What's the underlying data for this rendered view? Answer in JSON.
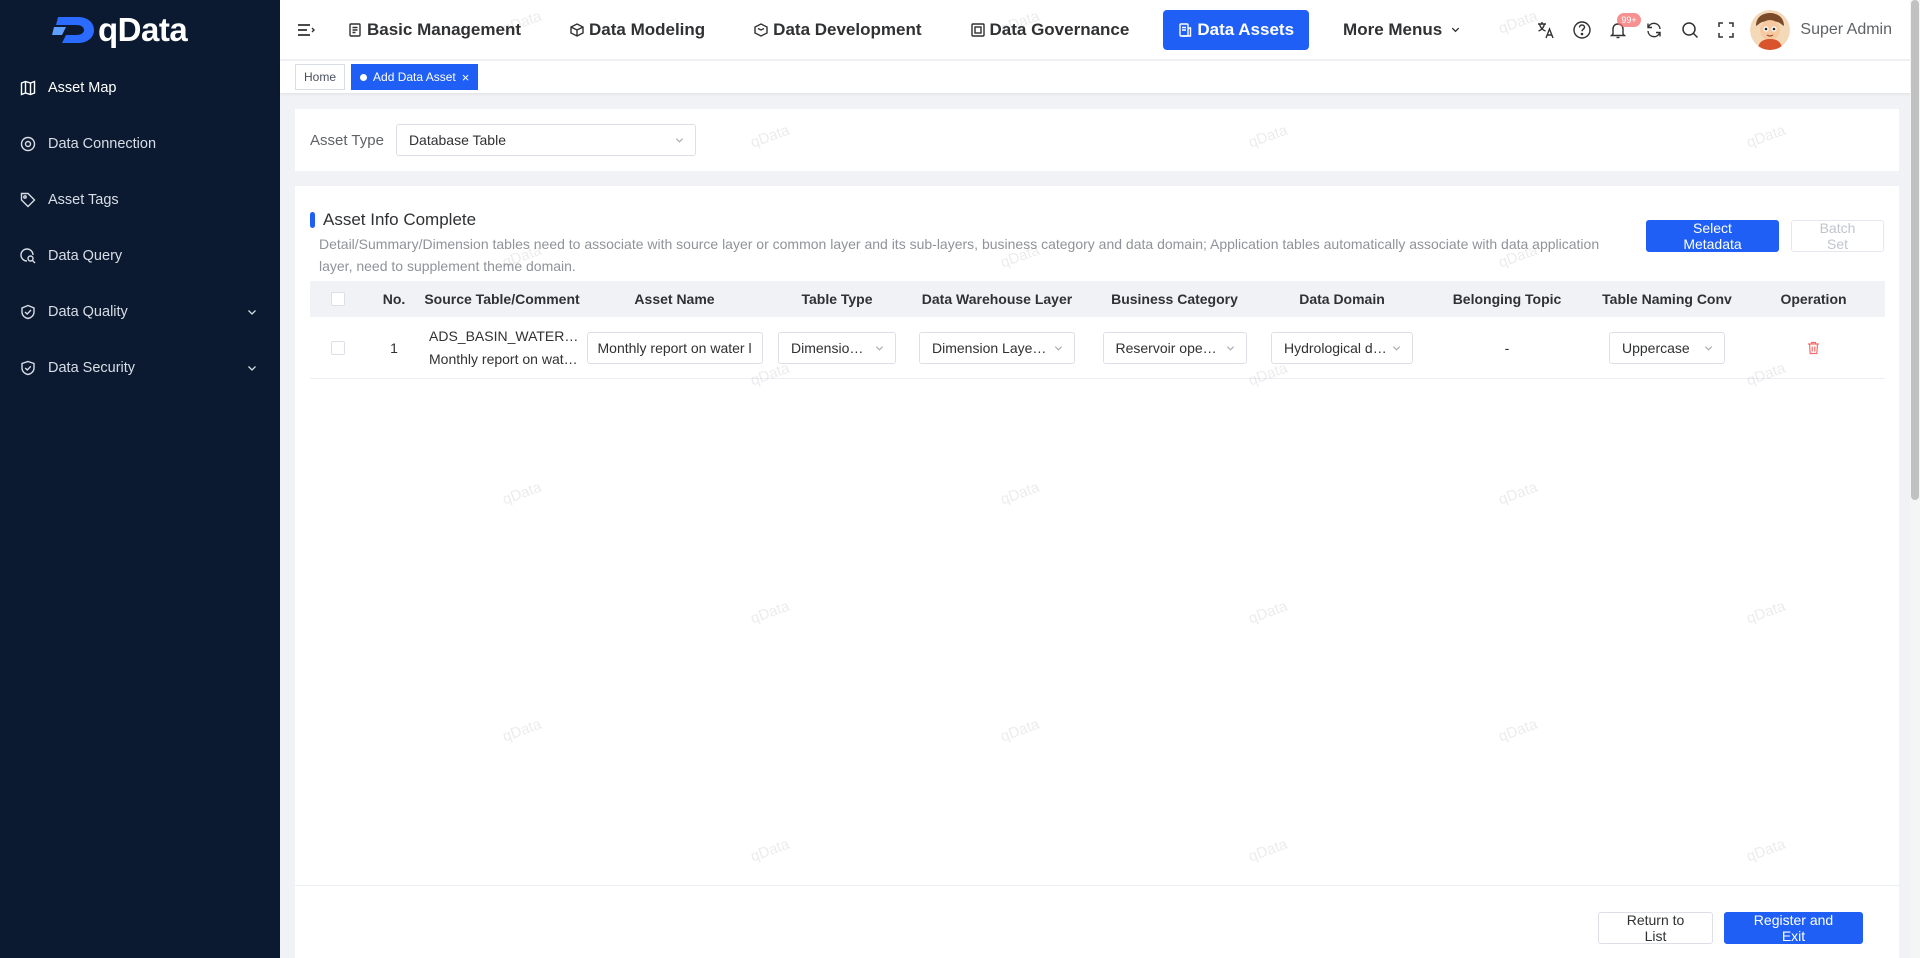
{
  "app": {
    "name": "qData"
  },
  "sidebar": {
    "items": [
      {
        "label": "Asset Map",
        "icon": "map-icon",
        "expandable": false
      },
      {
        "label": "Data Connection",
        "icon": "connection-icon",
        "expandable": false
      },
      {
        "label": "Asset Tags",
        "icon": "tag-icon",
        "expandable": false
      },
      {
        "label": "Data Query",
        "icon": "query-icon",
        "expandable": false
      },
      {
        "label": "Data Quality",
        "icon": "quality-icon",
        "expandable": true
      },
      {
        "label": "Data Security",
        "icon": "shield-icon",
        "expandable": true
      }
    ]
  },
  "topnav": {
    "items": [
      {
        "label": "Basic Management"
      },
      {
        "label": "Data Modeling"
      },
      {
        "label": "Data Development"
      },
      {
        "label": "Data Governance"
      },
      {
        "label": "Data Assets",
        "active": true
      },
      {
        "label": "More Menus"
      }
    ]
  },
  "header": {
    "notification_badge": "99+",
    "username": "Super Admin"
  },
  "tabs": {
    "home": "Home",
    "active": "Add Data Asset",
    "close_glyph": "×"
  },
  "asset_type": {
    "label": "Asset Type",
    "value": "Database Table"
  },
  "section": {
    "title": "Asset Info Complete",
    "description": "Detail/Summary/Dimension tables need to associate with source layer or common layer and its sub-layers, business category and data domain; Application tables automatically associate with data application layer, need to supplement theme domain.",
    "select_metadata_label": "Select Metadata",
    "batch_set_label": "Batch Set"
  },
  "table": {
    "columns": [
      "No.",
      "Source Table/Comment",
      "Asset Name",
      "Table Type",
      "Data Warehouse Layer",
      "Business Category",
      "Data Domain",
      "Belonging Topic",
      "Table Naming Conv",
      "Operation"
    ],
    "rows": [
      {
        "no": "1",
        "source_table": "ADS_BASIN_WATER_MONTHLY_REPORT",
        "source_comment": "Monthly report on water level of basin",
        "asset_name": "Monthly report on water level of basin",
        "table_type": "Dimension Table",
        "dw_layer": "Dimension Layer (DIM)",
        "business_category": "Reservoir operation",
        "data_domain": "Hydrological data",
        "topic": "-",
        "naming": "Uppercase"
      }
    ]
  },
  "footer": {
    "return_label": "Return to List",
    "register_label": "Register and Exit"
  },
  "watermark": {
    "text": "qData"
  },
  "colors": {
    "primary": "#1f5ff6",
    "sidebar_bg": "#0b1a30",
    "danger": "#f56c6c"
  }
}
